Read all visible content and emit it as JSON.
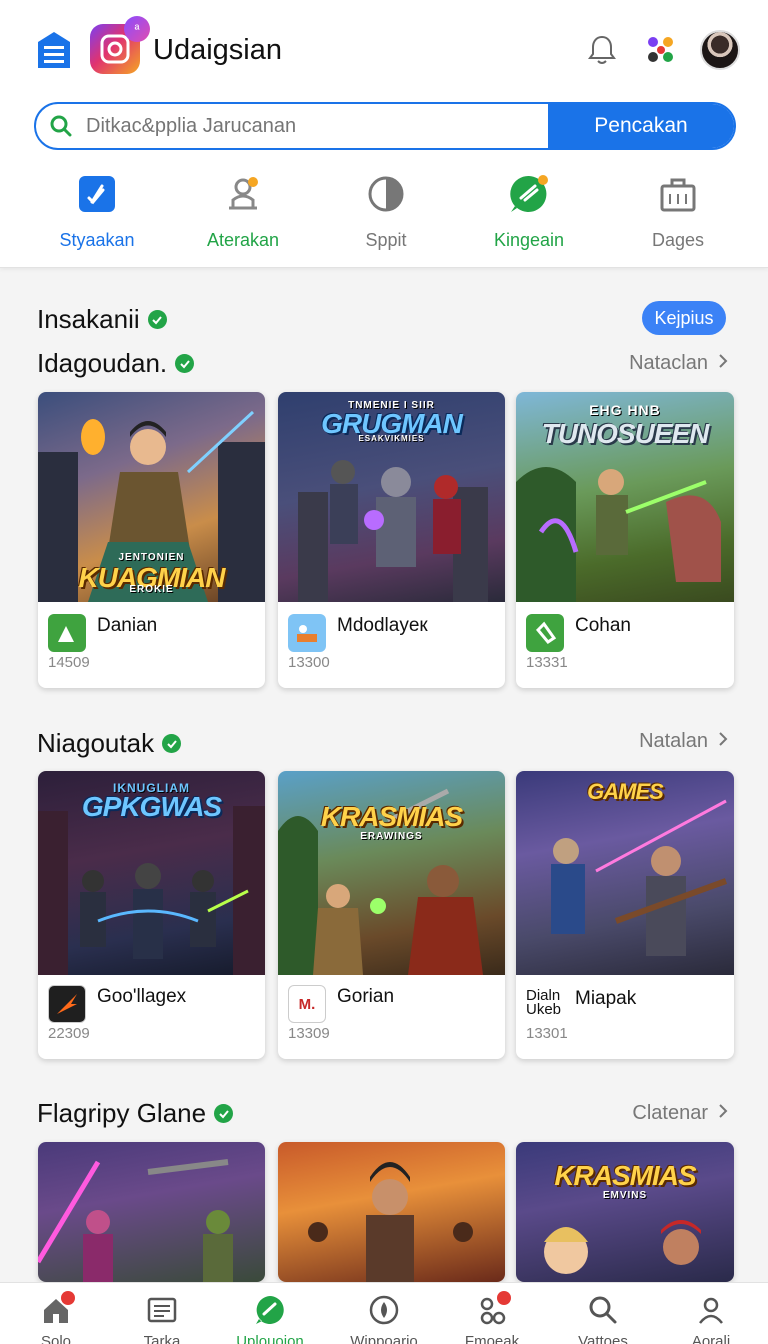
{
  "header": {
    "app_title": "Udaigsian",
    "search_placeholder": "Ditkac&pplia Jarucanan",
    "search_button": "Pencakan"
  },
  "tabs": [
    {
      "label": "Styaakan",
      "icon": "music-note-icon",
      "color": "#1a73e8"
    },
    {
      "label": "Aterakan",
      "icon": "user-podium-icon",
      "color": "#22a447"
    },
    {
      "label": "Sppit",
      "icon": "pie-chart-icon",
      "color": "#888888"
    },
    {
      "label": "Kingeain",
      "icon": "chat-bubble-icon",
      "color": "#22a447"
    },
    {
      "label": "Dages",
      "icon": "briefcase-icon",
      "color": "#888888"
    }
  ],
  "sections": [
    {
      "title": "Insakanii",
      "badge": "Kejpius"
    },
    {
      "title": "Idagoudan.",
      "see_more": "Nataclan",
      "cards": [
        {
          "art_title": "KUAGMIAN",
          "art_sub": "JENTONIEN",
          "art_sub2": "EROKIE",
          "name": "Danian",
          "count": "14509"
        },
        {
          "art_title": "GRUGMAN",
          "art_sub": "TNMENIE I SIIR",
          "art_sub2": "ESAKVIKMIES",
          "name": "Mdodlayeк",
          "count": "13300"
        },
        {
          "art_title": "TUNOSUEEN",
          "art_sub": "EHG HNB",
          "art_sub2": "",
          "name": "Cohan",
          "count": "13331"
        }
      ]
    },
    {
      "title": "Niagoutak",
      "see_more": "Natalan",
      "cards": [
        {
          "art_title": "GPKGWAS",
          "art_sub": "IKNUGLIAM",
          "art_sub2": "",
          "name": "Goo'llagex",
          "count": "22309"
        },
        {
          "art_title": "KRASMIAS",
          "art_sub": "ERAWINGS",
          "art_sub2": "",
          "name": "Gorian",
          "count": "13309",
          "icon_text": "M."
        },
        {
          "art_title": "GAMES",
          "art_sub": "",
          "art_sub2": "",
          "name_line1": "Dialn",
          "name_line2": "Ukeb",
          "name": "Miapak",
          "count": "13301"
        }
      ]
    },
    {
      "title": "Flagripy Glane",
      "see_more": "Clatenar",
      "cards": [
        {
          "art_title": ""
        },
        {
          "art_title": ""
        },
        {
          "art_title": "KRASMIAS",
          "art_sub": "EMVINS"
        }
      ]
    }
  ],
  "bottom_nav": [
    {
      "label": "Solo",
      "icon": "home-icon"
    },
    {
      "label": "Tarka",
      "icon": "news-icon"
    },
    {
      "label": "Uplouoion",
      "icon": "chat-icon",
      "color": "#22a447"
    },
    {
      "label": "Wippoario",
      "icon": "compass-icon"
    },
    {
      "label": "Fmoeak",
      "icon": "people-icon"
    },
    {
      "label": "Vattoes",
      "icon": "search-icon"
    },
    {
      "label": "Aorali",
      "icon": "profile-icon"
    }
  ]
}
